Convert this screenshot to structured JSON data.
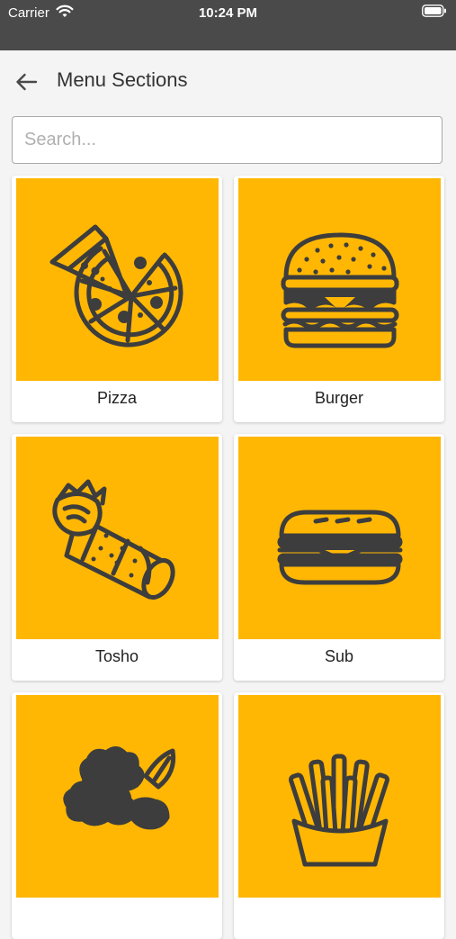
{
  "status_bar": {
    "carrier": "Carrier",
    "time": "10:24 PM"
  },
  "header": {
    "title": "Menu Sections"
  },
  "search": {
    "placeholder": "Search..."
  },
  "theme": {
    "tile_color": "#ffb703",
    "icon_color": "#3d3d3d"
  },
  "sections": [
    {
      "label": "Pizza",
      "icon": "pizza-icon"
    },
    {
      "label": "Burger",
      "icon": "burger-icon"
    },
    {
      "label": "Tosho",
      "icon": "wrap-icon"
    },
    {
      "label": "Sub",
      "icon": "sub-sandwich-icon"
    },
    {
      "label": "",
      "icon": "salad-icon"
    },
    {
      "label": "",
      "icon": "fries-icon"
    }
  ]
}
